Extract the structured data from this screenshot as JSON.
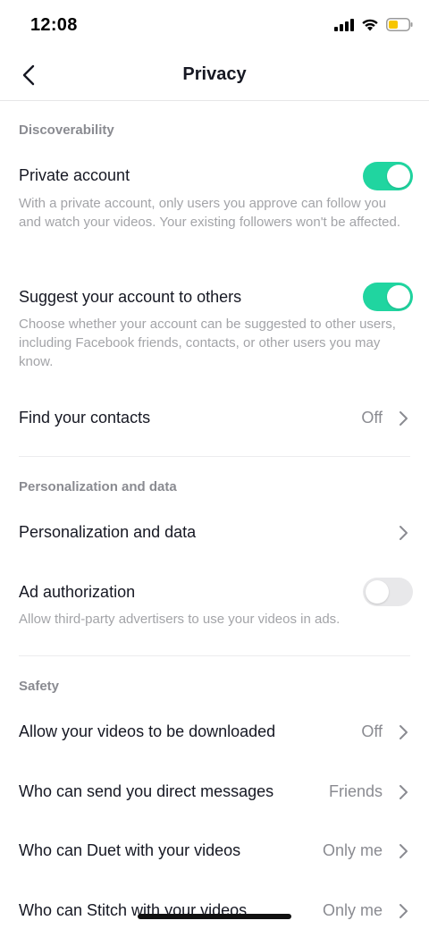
{
  "status_bar": {
    "time": "12:08"
  },
  "header": {
    "title": "Privacy"
  },
  "sections": {
    "discoverability": {
      "header": "Discoverability",
      "private_account": {
        "title": "Private account",
        "description": "With a private account, only users you approve can follow you and watch your videos. Your existing followers won't be affected.",
        "enabled": true
      },
      "suggest_account": {
        "title": "Suggest your account to others",
        "description": "Choose whether your account can be suggested to other users, including Facebook friends, contacts, or other users you may know.",
        "enabled": true
      },
      "find_contacts": {
        "title": "Find your contacts",
        "value": "Off"
      }
    },
    "personalization": {
      "header": "Personalization and data",
      "personalization_data": {
        "title": "Personalization and data"
      },
      "ad_authorization": {
        "title": "Ad authorization",
        "description": "Allow third-party advertisers to use your videos in ads.",
        "enabled": false
      }
    },
    "safety": {
      "header": "Safety",
      "downloads": {
        "title": "Allow your videos to be downloaded",
        "value": "Off"
      },
      "direct_messages": {
        "title": "Who can send you direct messages",
        "value": "Friends"
      },
      "duet": {
        "title": "Who can Duet with your videos",
        "value": "Only me"
      },
      "stitch": {
        "title": "Who can Stitch with your videos",
        "value": "Only me"
      }
    }
  },
  "colors": {
    "toggle_on": "#20d5a0",
    "toggle_off": "#e8e8ea",
    "battery": "#f7c600"
  }
}
